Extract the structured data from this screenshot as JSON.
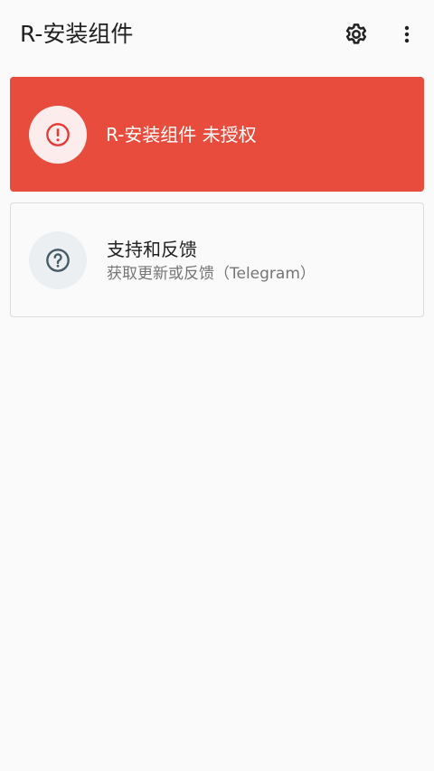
{
  "app_bar": {
    "title": "R-安装组件",
    "actions": [
      {
        "icon": "gear-icon"
      },
      {
        "icon": "more-vert-icon"
      }
    ]
  },
  "status_card": {
    "text": "R-安装组件 未授权",
    "icon": "alert-circle-icon",
    "background_color": "#e74c3c",
    "icon_color": "#e53935"
  },
  "support_card": {
    "title": "支持和反馈",
    "subtitle": "获取更新或反馈（Telegram）",
    "icon": "help-circle-icon",
    "icon_color": "#455a64"
  }
}
